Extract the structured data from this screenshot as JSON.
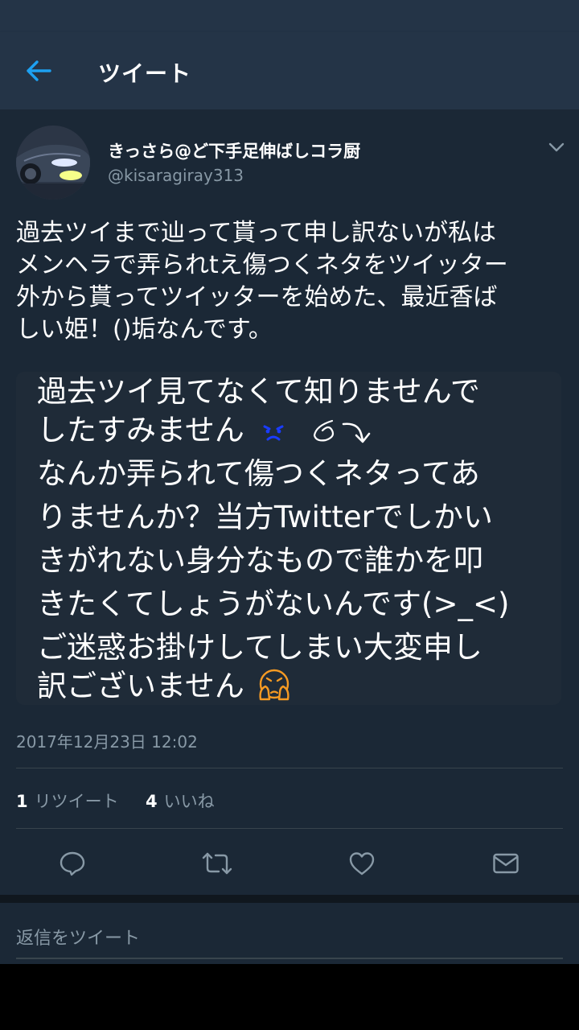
{
  "header": {
    "title": "ツイート",
    "back_icon": "arrow-left-icon"
  },
  "tweet": {
    "display_name": "きっさら@ど下手足伸ばしコラ厨",
    "handle": "@kisaragiray313",
    "text_lines": [
      "過去ツイまで辿って貰って申し訳ないが私は",
      "メンヘラで弄られtえ傷つくネタをツイッター",
      "外から貰ってツイッターを始めた、最近香ば",
      "しい姫！()垢なんです。"
    ],
    "media_lines": [
      "過去ツイ見てなくて知りませんで",
      "したすみません",
      "なんか弄られて傷つくネタってあ",
      "りませんか？当方Twitterでしかい",
      "きがれない身分なもので誰かを叩",
      "きたくてしょうがないんです(>_<)",
      "ご迷惑お掛けしてしまい大変申し",
      "訳ございません"
    ],
    "timestamp": "2017年12月23日 12:02",
    "retweet_count": "1",
    "retweet_label": "リツイート",
    "like_count": "4",
    "like_label": "いいね"
  },
  "actions": [
    "reply-icon",
    "retweet-icon",
    "like-icon",
    "message-icon"
  ],
  "reply": {
    "placeholder": "返信をツイート"
  },
  "colors": {
    "background": "#1b2836",
    "header": "#243447",
    "accent": "#1da1f2",
    "secondary_text": "#8899a6",
    "divider": "#38444d"
  }
}
